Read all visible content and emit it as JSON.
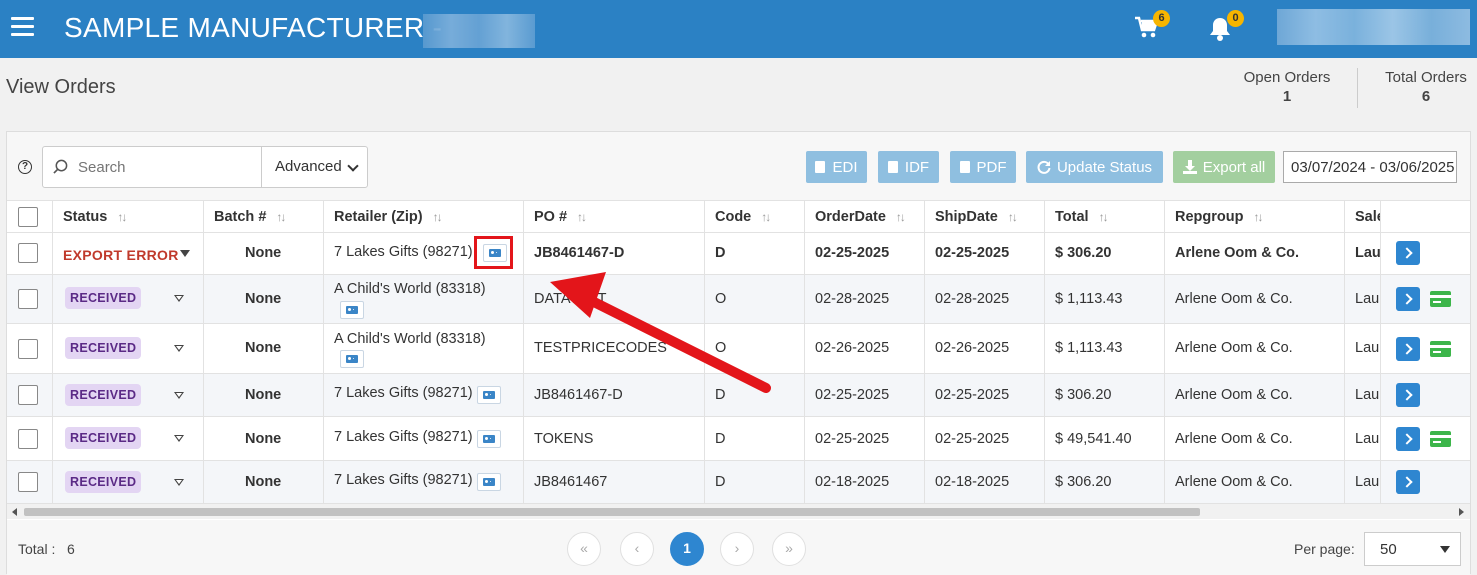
{
  "header": {
    "app_title": "SAMPLE MANUFACTURER -",
    "cart_count": "6",
    "notification_count": "0"
  },
  "page": {
    "title": "View Orders",
    "open_orders_label": "Open Orders",
    "open_orders_value": "1",
    "total_orders_label": "Total Orders",
    "total_orders_value": "6"
  },
  "toolbar": {
    "help": "?",
    "search_placeholder": "Search",
    "advanced_label": "Advanced",
    "edi_label": "EDI",
    "idf_label": "IDF",
    "pdf_label": "PDF",
    "update_status_label": "Update Status",
    "export_all_label": "Export all",
    "date_range": "03/07/2024 - 03/06/2025"
  },
  "table": {
    "columns": {
      "status": "Status",
      "batch": "Batch #",
      "retailer": "Retailer (Zip)",
      "po": "PO #",
      "code": "Code",
      "order_date": "OrderDate",
      "ship_date": "ShipDate",
      "total": "Total",
      "repgroup": "Repgroup",
      "sales": "Sale"
    },
    "rows": [
      {
        "status": "EXPORT ERROR",
        "batch": "None",
        "retailer": "7 Lakes Gifts (98271)",
        "po": "JB8461467-D",
        "code": "D",
        "order_date": "02-25-2025",
        "ship_date": "02-25-2025",
        "total": "$ 306.20",
        "repgroup": "Arlene Oom & Co.",
        "sales": "Lau"
      },
      {
        "status": "RECEIVED",
        "batch": "None",
        "retailer": "A Child's World (83318)",
        "po": "DATATEST",
        "code": "O",
        "order_date": "02-28-2025",
        "ship_date": "02-28-2025",
        "total": "$ 1,113.43",
        "repgroup": "Arlene Oom & Co.",
        "sales": "Lau"
      },
      {
        "status": "RECEIVED",
        "batch": "None",
        "retailer": "A Child's World (83318)",
        "po": "TESTPRICECODES",
        "code": "O",
        "order_date": "02-26-2025",
        "ship_date": "02-26-2025",
        "total": "$ 1,113.43",
        "repgroup": "Arlene Oom & Co.",
        "sales": "Lau"
      },
      {
        "status": "RECEIVED",
        "batch": "None",
        "retailer": "7 Lakes Gifts (98271)",
        "po": "JB8461467-D",
        "code": "D",
        "order_date": "02-25-2025",
        "ship_date": "02-25-2025",
        "total": "$ 306.20",
        "repgroup": "Arlene Oom & Co.",
        "sales": "Lau"
      },
      {
        "status": "RECEIVED",
        "batch": "None",
        "retailer": "7 Lakes Gifts (98271)",
        "po": "TOKENS",
        "code": "D",
        "order_date": "02-25-2025",
        "ship_date": "02-25-2025",
        "total": "$ 49,541.40",
        "repgroup": "Arlene Oom & Co.",
        "sales": "Lau"
      },
      {
        "status": "RECEIVED",
        "batch": "None",
        "retailer": "7 Lakes Gifts (98271)",
        "po": "JB8461467",
        "code": "D",
        "order_date": "02-18-2025",
        "ship_date": "02-18-2025",
        "total": "$ 306.20",
        "repgroup": "Arlene Oom & Co.",
        "sales": "Lau"
      }
    ]
  },
  "footer": {
    "total_label": "Total :",
    "total_value": "6",
    "first": "«",
    "prev": "‹",
    "current_page": "1",
    "next": "›",
    "last": "»",
    "per_page_label": "Per page:",
    "per_page_value": "50"
  },
  "colors": {
    "header_bg": "#2b81c4",
    "accent": "#2e86d0",
    "error": "#c0392b",
    "received_bg": "#e3d5f3",
    "annotation": "#e3151a"
  }
}
